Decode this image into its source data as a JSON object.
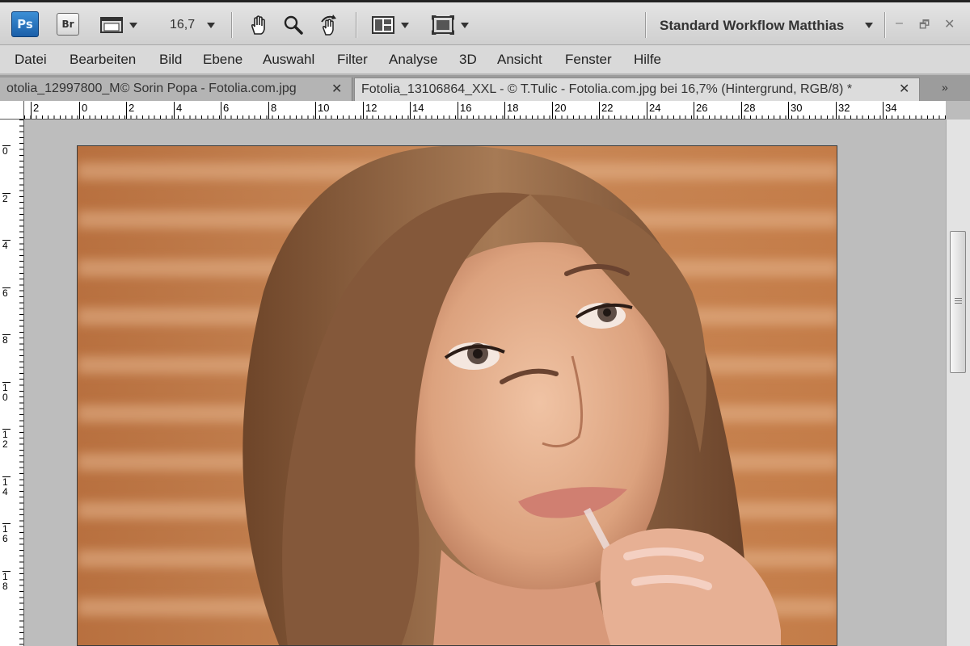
{
  "app": {
    "ps_label": "Ps",
    "br_label": "Br",
    "zoom": "16,7",
    "workspace": "Standard Workflow Matthias",
    "window_controls": [
      "–",
      "🗗",
      "✕"
    ]
  },
  "menu": [
    "Datei",
    "Bearbeiten",
    "Bild",
    "Ebene",
    "Auswahl",
    "Filter",
    "Analyse",
    "3D",
    "Ansicht",
    "Fenster",
    "Hilfe"
  ],
  "tabs": [
    {
      "label": "otolia_12997800_M© Sorin Popa - Fotolia.com.jpg",
      "active": false
    },
    {
      "label": "Fotolia_13106864_XXL - © T.Tulic - Fotolia.com.jpg bei 16,7% (Hintergrund, RGB/8) *",
      "active": true
    }
  ],
  "tab_close": "✕",
  "tab_overflow": "»",
  "ruler_h": [
    "2",
    "0",
    "2",
    "4",
    "6",
    "8",
    "10",
    "12",
    "14",
    "16",
    "18",
    "20",
    "22",
    "24",
    "26",
    "28",
    "30",
    "32",
    "34"
  ],
  "ruler_v": [
    "0",
    "2",
    "4",
    "6",
    "8",
    "10",
    "12",
    "14",
    "16",
    "18"
  ],
  "colors": {
    "accent_ps": "#1b5fa8",
    "photo_bg": "#b56a3c",
    "hair": "#8a5a38",
    "skin": "#e2aa88"
  }
}
